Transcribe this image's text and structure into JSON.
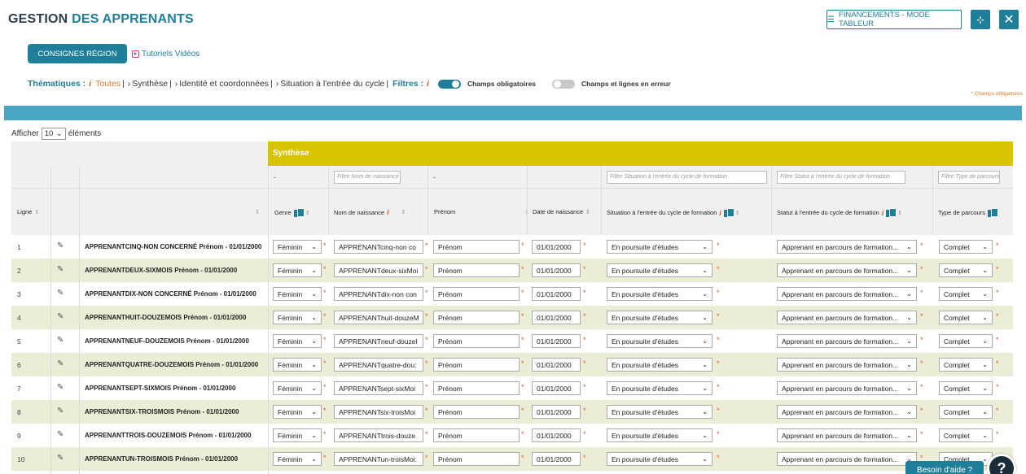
{
  "header": {
    "title_part1": "GESTION",
    "title_part2": "DES APPRENANTS",
    "financements_label": "FINANCEMENTS - MODE TABLEUR",
    "compress_icon": "compress-icon",
    "close_icon": "close-icon"
  },
  "consignes_label": "CONSIGNES RÉGION",
  "tutoriels_label": "Tutoriels Vidéos",
  "thematiques": {
    "label": "Thématiques :",
    "info": "i",
    "items": [
      "Toutes",
      "Synthèse",
      "Identité et coordonnées",
      "Situation à l'entrée du cycle"
    ],
    "filters_label": "Filtres :",
    "toggle1_label": "Champs obligatoires",
    "toggle1_on": true,
    "toggle2_label": "Champs et lignes en erreur",
    "toggle2_on": false
  },
  "champs_obligatoires_note": "* Champs obligatoires",
  "afficher": {
    "prefix": "Afficher",
    "value": "10",
    "suffix": "éléments"
  },
  "table": {
    "group_label": "Synthèse",
    "filters": {
      "genre": "-",
      "nom": "Filtre Nom de naissance",
      "prenom": "-",
      "situation": "Filtre Situation à l'entrée du cycle de formation",
      "statut": "Filtre Statut à l'entrée du cycle de formation",
      "type": "Filtre Type de parcours"
    },
    "headers": {
      "ligne": "Ligne",
      "genre": "Genre",
      "nom": "Nom de naissance",
      "prenom": "Prénom",
      "date": "Date de naissance",
      "situation": "Situation à l'entrée du cycle de formation",
      "statut": "Statut à l'entrée du cycle de formation",
      "type": "Type de parcours"
    },
    "rows": [
      {
        "num": "1",
        "name": "APPRENANTCINQ-NON CONCERNÉ Prénom - 01/01/2000",
        "genre": "Féminin",
        "nom": "APPRENANTcinq-non co",
        "prenom": "Prénom",
        "date": "01/01/2000",
        "situation": "En poursuite d'études",
        "statut": "Apprenant en parcours de formation...",
        "type": "Complet"
      },
      {
        "num": "2",
        "name": "APPRENANTDEUX-SIXMOIS Prénom - 01/01/2000",
        "genre": "Féminin",
        "nom": "APPRENANTdeux-sixMoi",
        "prenom": "Prénom",
        "date": "01/01/2000",
        "situation": "En poursuite d'études",
        "statut": "Apprenant en parcours de formation...",
        "type": "Complet"
      },
      {
        "num": "3",
        "name": "APPRENANTDIX-NON CONCERNÉ Prénom - 01/01/2000",
        "genre": "Féminin",
        "nom": "APPRENANTdix-non con",
        "prenom": "Prénom",
        "date": "01/01/2000",
        "situation": "En poursuite d'études",
        "statut": "Apprenant en parcours de formation...",
        "type": "Complet"
      },
      {
        "num": "4",
        "name": "APPRENANTHUIT-DOUZEMOIS Prénom - 01/01/2000",
        "genre": "Féminin",
        "nom": "APPRENANThuit-douzeM",
        "prenom": "Prénom",
        "date": "01/01/2000",
        "situation": "En poursuite d'études",
        "statut": "Apprenant en parcours de formation...",
        "type": "Complet"
      },
      {
        "num": "5",
        "name": "APPRENANTNEUF-DOUZEMOIS Prénom - 01/01/2000",
        "genre": "Féminin",
        "nom": "APPRENANTneuf-douzeI",
        "prenom": "Prénom",
        "date": "01/01/2000",
        "situation": "En poursuite d'études",
        "statut": "Apprenant en parcours de formation...",
        "type": "Complet"
      },
      {
        "num": "6",
        "name": "APPRENANTQUATRE-DOUZEMOIS Prénom - 01/01/2000",
        "genre": "Féminin",
        "nom": "APPRENANTquatre-dou:",
        "prenom": "Prénom",
        "date": "01/01/2000",
        "situation": "En poursuite d'études",
        "statut": "Apprenant en parcours de formation...",
        "type": "Complet"
      },
      {
        "num": "7",
        "name": "APPRENANTSEPT-SIXMOIS Prénom - 01/01/2000",
        "genre": "Féminin",
        "nom": "APPRENANTsept-sixMoi",
        "prenom": "Prénom",
        "date": "01/01/2000",
        "situation": "En poursuite d'études",
        "statut": "Apprenant en parcours de formation...",
        "type": "Complet"
      },
      {
        "num": "8",
        "name": "APPRENANTSIX-TROISMOIS Prénom - 01/01/2000",
        "genre": "Féminin",
        "nom": "APPRENANTsix-troisMoi",
        "prenom": "Prénom",
        "date": "01/01/2000",
        "situation": "En poursuite d'études",
        "statut": "Apprenant en parcours de formation...",
        "type": "Complet"
      },
      {
        "num": "9",
        "name": "APPRENANTTROIS-DOUZEMOIS Prénom - 01/01/2000",
        "genre": "Féminin",
        "nom": "APPRENANTtrois-douze",
        "prenom": "Prénom",
        "date": "01/01/2000",
        "situation": "En poursuite d'études",
        "statut": "Apprenant en parcours de formation...",
        "type": "Complet"
      },
      {
        "num": "10",
        "name": "APPRENANTUN-TROISMOIS Prénom - 01/01/2000",
        "genre": "Féminin",
        "nom": "APPRENANTun-troisMoi:",
        "prenom": "Prénom",
        "date": "01/01/2000",
        "situation": "En poursuite d'études",
        "statut": "Apprenant en parcours de formation...",
        "type": "Complet"
      }
    ]
  },
  "help_label": "Besoin d'aide ?",
  "colors": {
    "teal": "#1f7f9a",
    "band": "#4aa7c4",
    "synth_yellow": "#d6c500",
    "row_alt": "#ebedd7",
    "accent_orange": "#e05a2a"
  }
}
